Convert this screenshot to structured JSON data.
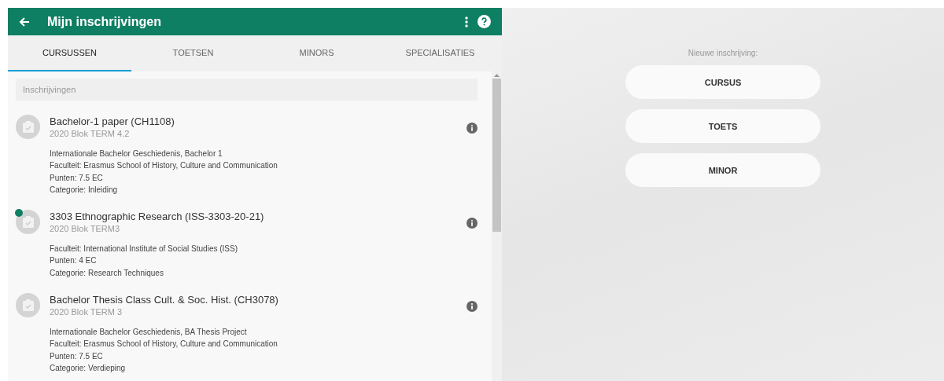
{
  "header": {
    "title": "Mijn inschrijvingen"
  },
  "tabs": [
    {
      "label": "CURSUSSEN",
      "selected": true
    },
    {
      "label": "TOETSEN",
      "selected": false
    },
    {
      "label": "MINORS",
      "selected": false
    },
    {
      "label": "SPECIALISATIES",
      "selected": false
    }
  ],
  "section_header": "Inschrijvingen",
  "enrollments": [
    {
      "title": "Bachelor-1 paper (CH1108)",
      "subtitle": "2020 Blok TERM 4.2",
      "new": false,
      "details": [
        "Internationale Bachelor Geschiedenis, Bachelor 1",
        "Faculteit: Erasmus School of History, Culture and Communication",
        "Punten: 7.5 EC",
        "Categorie: Inleiding"
      ]
    },
    {
      "title": "3303 Ethnographic Research (ISS-3303-20-21)",
      "subtitle": "2020 Blok TERM3",
      "new": true,
      "details": [
        "Faculteit: International Institute of Social Studies (ISS)",
        "Punten: 4 EC",
        "Categorie: Research Techniques"
      ]
    },
    {
      "title": "Bachelor Thesis Class Cult. & Soc. Hist. (CH3078)",
      "subtitle": "2020 Blok TERM 3",
      "new": false,
      "details": [
        "Internationale Bachelor Geschiedenis, BA Thesis Project",
        "Faculteit: Erasmus School of History, Culture and Communication",
        "Punten: 7.5 EC",
        "Categorie: Verdieping"
      ]
    }
  ],
  "new_enrollment": {
    "label": "Nieuwe inschrijving:",
    "buttons": [
      "CURSUS",
      "TOETS",
      "MINOR"
    ]
  }
}
